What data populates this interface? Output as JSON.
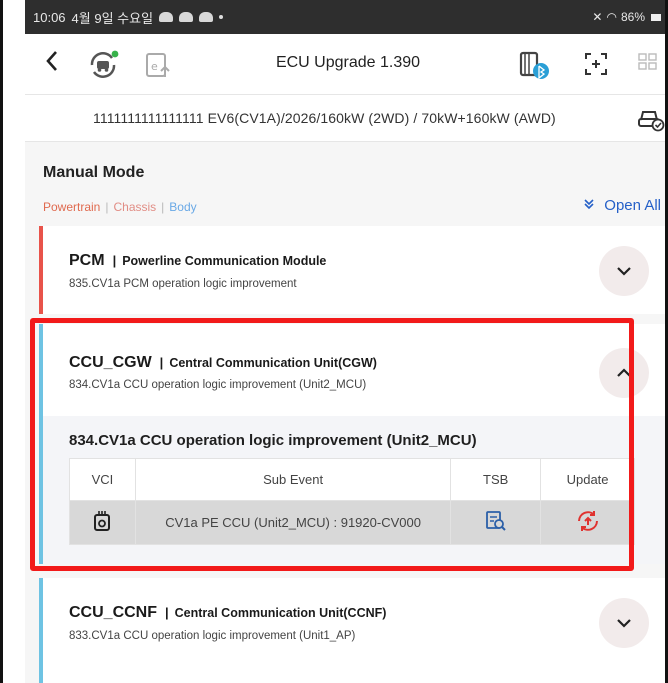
{
  "status_bar": {
    "time": "10:06",
    "date": "4월 9일 수요일",
    "battery": "86%"
  },
  "header": {
    "title": "ECU Upgrade 1.390",
    "icons": [
      "back-icon",
      "vehicle-scan-icon",
      "ecu-upload-icon",
      "ecu-bluetooth-icon",
      "expand-icon",
      "grid-icon"
    ]
  },
  "vehicle": {
    "info": "1111111111111111  EV6(CV1A)/2026/160kW (2WD) / 70kW+160kW (AWD)"
  },
  "main": {
    "mode_title": "Manual Mode",
    "filters": {
      "powertrain": "Powertrain",
      "chassis": "Chassis",
      "body": "Body",
      "separator": "|"
    },
    "open_all": "Open All",
    "modules": [
      {
        "code": "PCM",
        "separator": "|",
        "name": "Powerline Communication Module",
        "subtitle": "835.CV1a PCM operation logic improvement",
        "accent": "#e8534a",
        "expanded": false
      },
      {
        "code": "CCU_CGW",
        "separator": "|",
        "name": "Central Communication Unit(CGW)",
        "subtitle": "834.CV1a CCU operation logic improvement (Unit2_MCU)",
        "accent": "#6ec3e3",
        "expanded": true,
        "detail": {
          "title": "834.CV1a CCU operation logic improvement (Unit2_MCU)",
          "columns": [
            "VCI",
            "Sub Event",
            "TSB",
            "Update"
          ],
          "rows": [
            {
              "vci": "vci-device-icon",
              "sub_event": "CV1a PE CCU (Unit2_MCU) : 91920-CV000",
              "tsb": "tsb-document-search-icon",
              "update": "update-sync-icon"
            }
          ]
        }
      },
      {
        "code": "CCU_CCNF",
        "separator": "|",
        "name": "Central Communication Unit(CCNF)",
        "subtitle": "833.CV1a CCU operation logic improvement (Unit1_AP)",
        "accent": "#6ec3e3",
        "expanded": false
      }
    ]
  },
  "colors": {
    "highlight": "#f21a1a",
    "open_all": "#2560c8",
    "update_icon": "#e0322f",
    "tsb_icon": "#2b5fa8"
  }
}
